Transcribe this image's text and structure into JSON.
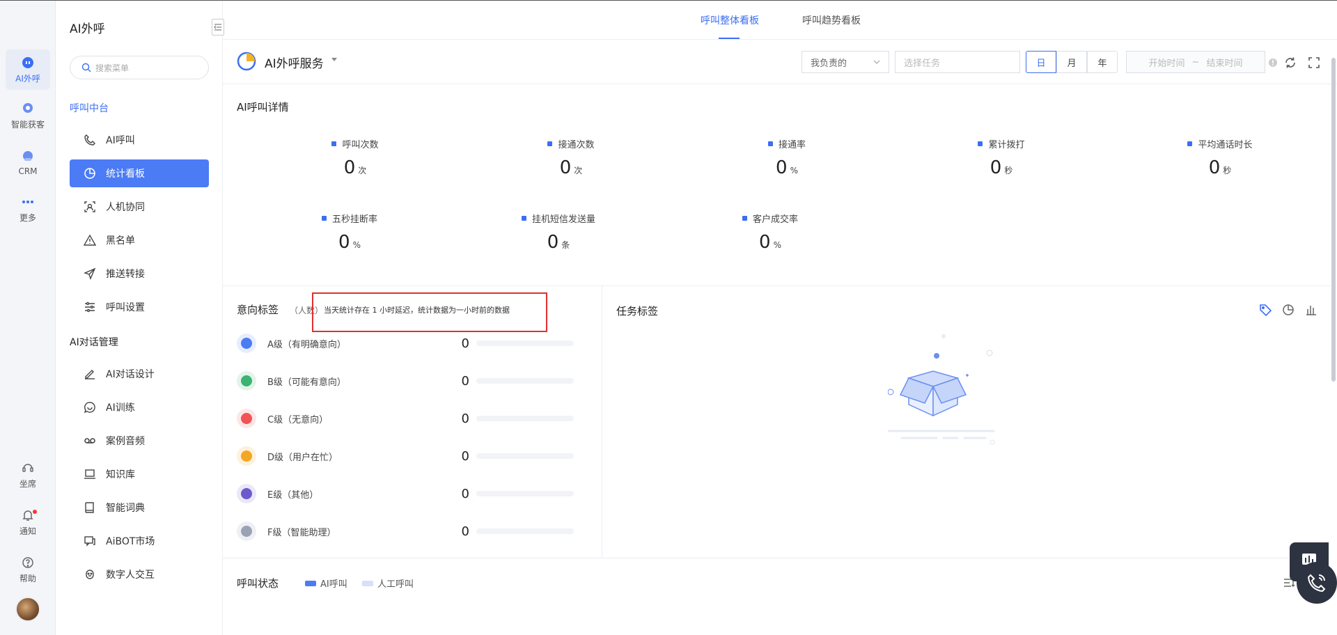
{
  "rail": {
    "items": [
      {
        "label": "AI外呼"
      },
      {
        "label": "智能获客"
      },
      {
        "label": "CRM"
      },
      {
        "label": "更多"
      },
      {
        "label": "坐席"
      },
      {
        "label": "通知"
      },
      {
        "label": "帮助"
      }
    ]
  },
  "sidebar": {
    "title": "AI外呼",
    "search_placeholder": "搜索菜单",
    "group1": "呼叫中台",
    "group1_items": [
      "AI呼叫",
      "统计看板",
      "人机协同",
      "黑名单",
      "推送转接",
      "呼叫设置"
    ],
    "group2": "AI对话管理",
    "group2_items": [
      "AI对话设计",
      "AI训练",
      "案例音频",
      "知识库",
      "智能词典",
      "AiBOT市场",
      "数字人交互"
    ]
  },
  "tabs": [
    "呼叫整体看板",
    "呼叫趋势看板"
  ],
  "toolbar": {
    "service": "AI外呼服务",
    "owner_filter": "我负责的",
    "task_placeholder": "选择任务",
    "segments": [
      "日",
      "月",
      "年"
    ],
    "start_placeholder": "开始时间",
    "range_sep": "~",
    "end_placeholder": "结束时间"
  },
  "stats": {
    "title": "AI呼叫详情",
    "items": [
      {
        "label": "呼叫次数",
        "value": "0",
        "unit": "次"
      },
      {
        "label": "接通次数",
        "value": "0",
        "unit": "次"
      },
      {
        "label": "接通率",
        "value": "0",
        "unit": "%"
      },
      {
        "label": "累计拨打",
        "value": "0",
        "unit": "秒"
      },
      {
        "label": "平均通话时长",
        "value": "0",
        "unit": "秒"
      },
      {
        "label": "五秒挂断率",
        "value": "0",
        "unit": "%"
      },
      {
        "label": "挂机短信发送量",
        "value": "0",
        "unit": "条"
      },
      {
        "label": "客户成交率",
        "value": "0",
        "unit": "%"
      }
    ]
  },
  "intent": {
    "title": "意向标签",
    "unit": "（人数）",
    "note": "当天统计存在 1 小时延迟，统计数据为一小时前的数据",
    "rows": [
      {
        "label": "A级（有明确意向）",
        "count": "0",
        "color": "#4b7bf5"
      },
      {
        "label": "B级（可能有意向）",
        "count": "0",
        "color": "#3cb371"
      },
      {
        "label": "C级（无意向）",
        "count": "0",
        "color": "#f05454"
      },
      {
        "label": "D级（用户在忙）",
        "count": "0",
        "color": "#f5a623"
      },
      {
        "label": "E级（其他）",
        "count": "0",
        "color": "#6a5acd"
      },
      {
        "label": "F级（智能助理）",
        "count": "0",
        "color": "#9aa3b5"
      }
    ]
  },
  "task": {
    "title": "任务标签"
  },
  "status": {
    "title": "呼叫状态",
    "legend": [
      {
        "label": "AI呼叫",
        "color": "#4b7bf5"
      },
      {
        "label": "人工呼叫",
        "color": "#d6e0fb"
      }
    ]
  }
}
